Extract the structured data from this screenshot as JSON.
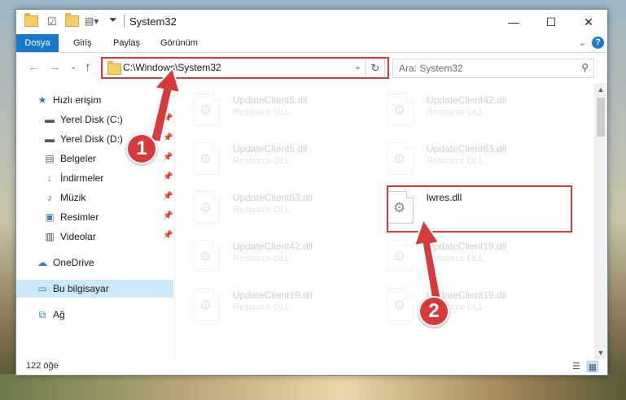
{
  "window": {
    "title": "System32",
    "minimize": "—",
    "maximize": "☐",
    "close": "✕"
  },
  "ribbon": {
    "tabs": [
      "Dosya",
      "Giriş",
      "Paylaş",
      "Görünüm"
    ],
    "help": "?"
  },
  "address": {
    "path": "C:\\Windows\\System32",
    "search_placeholder": "Ara: System32"
  },
  "sidebar": {
    "quick_access": "Hızlı erişim",
    "items": [
      {
        "label": "Yerel Disk (C:)",
        "icon": "drive-icon"
      },
      {
        "label": "Yerel Disk (D:)",
        "icon": "drive-icon"
      },
      {
        "label": "Belgeler",
        "icon": "documents-icon"
      },
      {
        "label": "İndirmeler",
        "icon": "downloads-icon"
      },
      {
        "label": "Müzik",
        "icon": "music-icon"
      },
      {
        "label": "Resimler",
        "icon": "pictures-icon"
      },
      {
        "label": "Videolar",
        "icon": "videos-icon"
      }
    ],
    "onedrive": "OneDrive",
    "this_pc": "Bu bilgisayar",
    "network": "Ağ"
  },
  "files": [
    {
      "name": "UpdateClient5.dll",
      "desc": "Resource DLL"
    },
    {
      "name": "UpdateClient42.dll",
      "desc": "Resource DLL"
    },
    {
      "name": "UpdateClient5.dll",
      "desc": "Resource DLL"
    },
    {
      "name": "UpdateClient63.dll",
      "desc": "Resource DLL"
    },
    {
      "name": "UpdateClient63.dll",
      "desc": "Resource DLL"
    },
    {
      "name": "lwres.dll",
      "desc": ""
    },
    {
      "name": "UpdateClient42.dll",
      "desc": "Resource DLL"
    },
    {
      "name": "UpdateClient19.dll",
      "desc": "Resource DLL"
    },
    {
      "name": "UpdateClient19.dll",
      "desc": "Resource DLL"
    },
    {
      "name": "UpdateClient19.dll",
      "desc": "Resource DLL"
    }
  ],
  "status": {
    "count": "122 öğe"
  },
  "markers": {
    "one": "1",
    "two": "2"
  },
  "colors": {
    "accent": "#1979ca",
    "highlight": "#d43c3c",
    "selection": "#cce8ff"
  }
}
